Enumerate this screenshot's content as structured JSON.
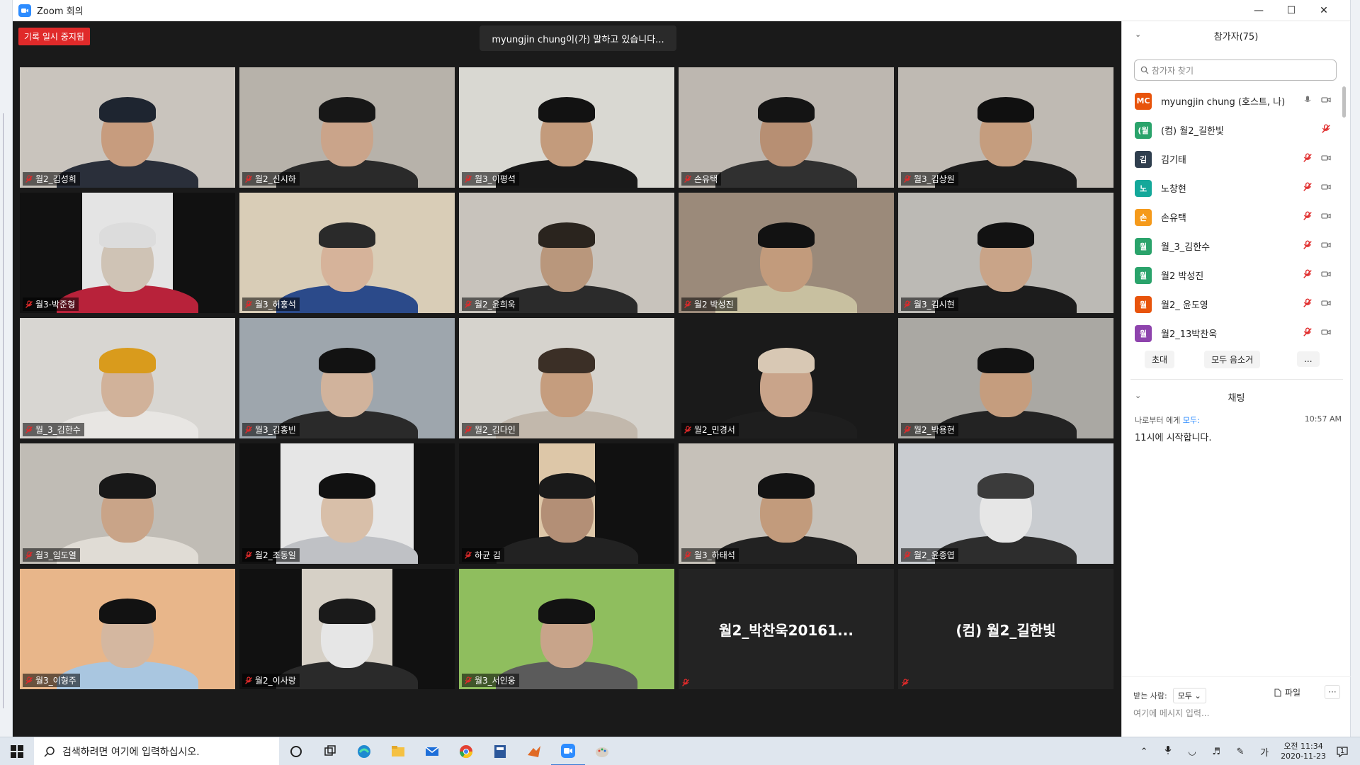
{
  "window": {
    "title": "Zoom 회의"
  },
  "meeting": {
    "recording_badge": "기록 일시 중지됨",
    "speaking_text": "myungjin chung이(가) 말하고 있습니다..."
  },
  "tiles": [
    {
      "name": "월2_김성희"
    },
    {
      "name": "월2_신시하"
    },
    {
      "name": "월3_이평석"
    },
    {
      "name": "손유택"
    },
    {
      "name": "월3_김상원"
    },
    {
      "name": "월3-박준형"
    },
    {
      "name": "월3_허홍석"
    },
    {
      "name": "월2_윤희욱"
    },
    {
      "name": "월2 박성진"
    },
    {
      "name": "월3_김시현"
    },
    {
      "name": "월_3_김한수"
    },
    {
      "name": "월3_김홍빈"
    },
    {
      "name": "월2_김다인"
    },
    {
      "name": "월2_민경서"
    },
    {
      "name": "월2_박용현"
    },
    {
      "name": "월3_임도열"
    },
    {
      "name": "월2_조동일"
    },
    {
      "name": "하균 김"
    },
    {
      "name": "월3_하태석"
    },
    {
      "name": "월2_윤종엽"
    },
    {
      "name": "월3_이형주"
    },
    {
      "name": "월2_이사랑"
    },
    {
      "name": "월3_서인웅"
    },
    {
      "name": "월2_박찬욱20161..."
    },
    {
      "name": "(컴) 월2_길한빛"
    }
  ],
  "participants_panel": {
    "title": "참가자(75)",
    "search_placeholder": "참가자 찾기",
    "items": [
      {
        "initials": "MC",
        "name": "myungjin chung (호스트, 나)",
        "color": "#e8540c"
      },
      {
        "initials": "(월",
        "name": "(컴) 월2_길한빛",
        "color": "#2aa36b"
      },
      {
        "initials": "김",
        "name": "김기태",
        "color": "#2f3e4e"
      },
      {
        "initials": "노",
        "name": "노창현",
        "color": "#14a89a"
      },
      {
        "initials": "손",
        "name": "손유택",
        "color": "#f59a1b"
      },
      {
        "initials": "월",
        "name": "월_3_김한수",
        "color": "#2aa36b"
      },
      {
        "initials": "월",
        "name": "월2 박성진",
        "color": "#2aa36b"
      },
      {
        "initials": "월",
        "name": "월2_ 윤도영",
        "color": "#e8540c"
      },
      {
        "initials": "월",
        "name": "월2_13박찬욱",
        "color": "#8e44ad"
      }
    ],
    "invite_label": "초대",
    "mute_all_label": "모두 음소거",
    "more_label": "..."
  },
  "chat_panel": {
    "title": "채팅",
    "message": {
      "from_prefix": "나로부터 에게",
      "to": "모두:",
      "time": "10:57 AM",
      "text": "11시에 시작합니다."
    },
    "recipient_label": "받는 사람:",
    "recipient_value": "모두",
    "file_label": "파일",
    "more_label": "···",
    "input_placeholder": "여기에 메시지 입력..."
  },
  "taskbar": {
    "search_placeholder": "검색하려면 여기에 입력하십시오.",
    "ime": "가",
    "time": "오전 11:34",
    "date": "2020-11-23",
    "notifications": "1"
  },
  "colors": {
    "video_bg": "#1a1a1a",
    "record_red": "#e02a2a",
    "mute_red": "#e02a2a",
    "zoom_blue": "#2D8CFF"
  }
}
